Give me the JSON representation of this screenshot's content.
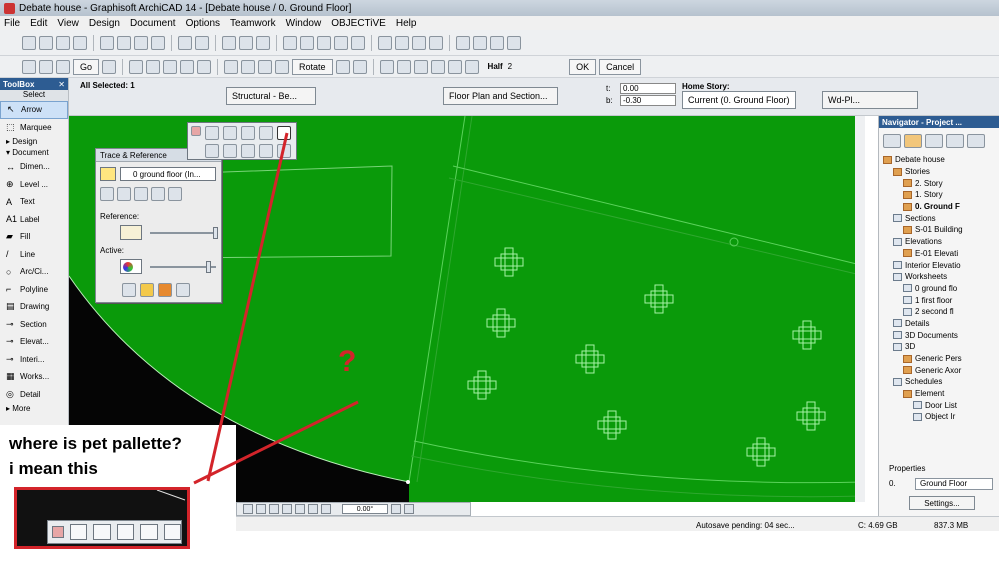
{
  "window": {
    "title": "Debate house - Graphisoft ArchiCAD 14 - [Debate house / 0. Ground Floor]"
  },
  "menu": [
    "File",
    "Edit",
    "View",
    "Design",
    "Document",
    "Options",
    "Teamwork",
    "Window",
    "OBJECTiVE",
    "Help"
  ],
  "toolbar": {
    "go_label": "Go",
    "rotate_label": "Rotate",
    "half_label": "Half",
    "half_sub": "2",
    "ok_label": "OK",
    "cancel_label": "Cancel"
  },
  "infobox": {
    "all_selected": "All Selected: 1",
    "structural_label": "Structural - Be...",
    "floorplan_label": "Floor Plan and Section...",
    "t_label": "t:",
    "b_label": "b:",
    "t_value": "0.00",
    "b_value": "-0.30",
    "home_story_label": "Home Story:",
    "home_story_value": "Current (0. Ground Floor)",
    "material_label": "Wd-Pl..."
  },
  "toolbox": {
    "title": "ToolBox",
    "select_label": "Select",
    "items": [
      {
        "label": "Arrow",
        "glyph": "↖"
      },
      {
        "label": "Marquee",
        "glyph": "⬚"
      }
    ],
    "group_design": "Design",
    "group_document": "Document",
    "doc_items": [
      {
        "label": "Dimen...",
        "glyph": "↔"
      },
      {
        "label": "Level ...",
        "glyph": "⊕"
      },
      {
        "label": "Text",
        "glyph": "A"
      },
      {
        "label": "Label",
        "glyph": "A1"
      },
      {
        "label": "Fill",
        "glyph": "▰"
      },
      {
        "label": "Line",
        "glyph": "/"
      },
      {
        "label": "Arc/Ci...",
        "glyph": "○"
      },
      {
        "label": "Polyline",
        "glyph": "⌐"
      },
      {
        "label": "Drawing",
        "glyph": "▤"
      },
      {
        "label": "Section",
        "glyph": "⊸"
      },
      {
        "label": "Elevat...",
        "glyph": "⊸"
      },
      {
        "label": "Interi...",
        "glyph": "⊸"
      },
      {
        "label": "Works...",
        "glyph": "▦"
      },
      {
        "label": "Detail",
        "glyph": "◎"
      }
    ],
    "more_label": "More"
  },
  "trace_palette": {
    "title": "Trace & Reference",
    "source": "0 ground floor (In...",
    "reference_label": "Reference:",
    "active_label": "Active:",
    "reference_level": 0.95,
    "active_level": 0.85
  },
  "navigator": {
    "title": "Navigator - Project ...",
    "tree": [
      {
        "label": "Debate house",
        "indent": 1,
        "icon": "house"
      },
      {
        "label": "Stories",
        "indent": 2,
        "icon": "folder"
      },
      {
        "label": "2. Story",
        "indent": 3,
        "icon": "folder"
      },
      {
        "label": "1. Story",
        "indent": 3,
        "icon": "folder"
      },
      {
        "label": "0. Ground F",
        "indent": 3,
        "icon": "folder",
        "bold": true
      },
      {
        "label": "Sections",
        "indent": 2,
        "icon": "doc"
      },
      {
        "label": "S-01 Building",
        "indent": 3,
        "icon": "folder"
      },
      {
        "label": "Elevations",
        "indent": 2,
        "icon": "doc"
      },
      {
        "label": "E-01 Elevati",
        "indent": 3,
        "icon": "folder"
      },
      {
        "label": "Interior Elevatio",
        "indent": 2,
        "icon": "doc"
      },
      {
        "label": "Worksheets",
        "indent": 2,
        "icon": "doc"
      },
      {
        "label": "0 ground flo",
        "indent": 3,
        "icon": "doc"
      },
      {
        "label": "1 first floor",
        "indent": 3,
        "icon": "doc"
      },
      {
        "label": "2 second fl",
        "indent": 3,
        "icon": "doc"
      },
      {
        "label": "Details",
        "indent": 2,
        "icon": "doc"
      },
      {
        "label": "3D Documents",
        "indent": 2,
        "icon": "doc"
      },
      {
        "label": "3D",
        "indent": 2,
        "icon": "doc"
      },
      {
        "label": "Generic Pers",
        "indent": 3,
        "icon": "folder"
      },
      {
        "label": "Generic Axor",
        "indent": 3,
        "icon": "folder"
      },
      {
        "label": "Schedules",
        "indent": 2,
        "icon": "doc"
      },
      {
        "label": "Element",
        "indent": 3,
        "icon": "folder"
      },
      {
        "label": "Door List",
        "indent": 4,
        "icon": "doc"
      },
      {
        "label": "Object Ir",
        "indent": 4,
        "icon": "doc"
      }
    ],
    "properties_label": "Properties",
    "prop_prefix": "0.",
    "prop_value": "Ground Floor",
    "settings_label": "Settings..."
  },
  "statusbar": {
    "left_text": "En",
    "autosave": "Autosave pending: 04 sec...",
    "disk": "C: 4.69 GB",
    "memory": "837.3 MB",
    "angle": "0.00°"
  },
  "annotation": {
    "question_mark": "?",
    "line1": "where is pet pallette?",
    "line2": "i mean this"
  },
  "colors": {
    "canvas": "#0a9a0a",
    "red": "#d3242a",
    "titlebar_blue": "#2d5c92"
  }
}
